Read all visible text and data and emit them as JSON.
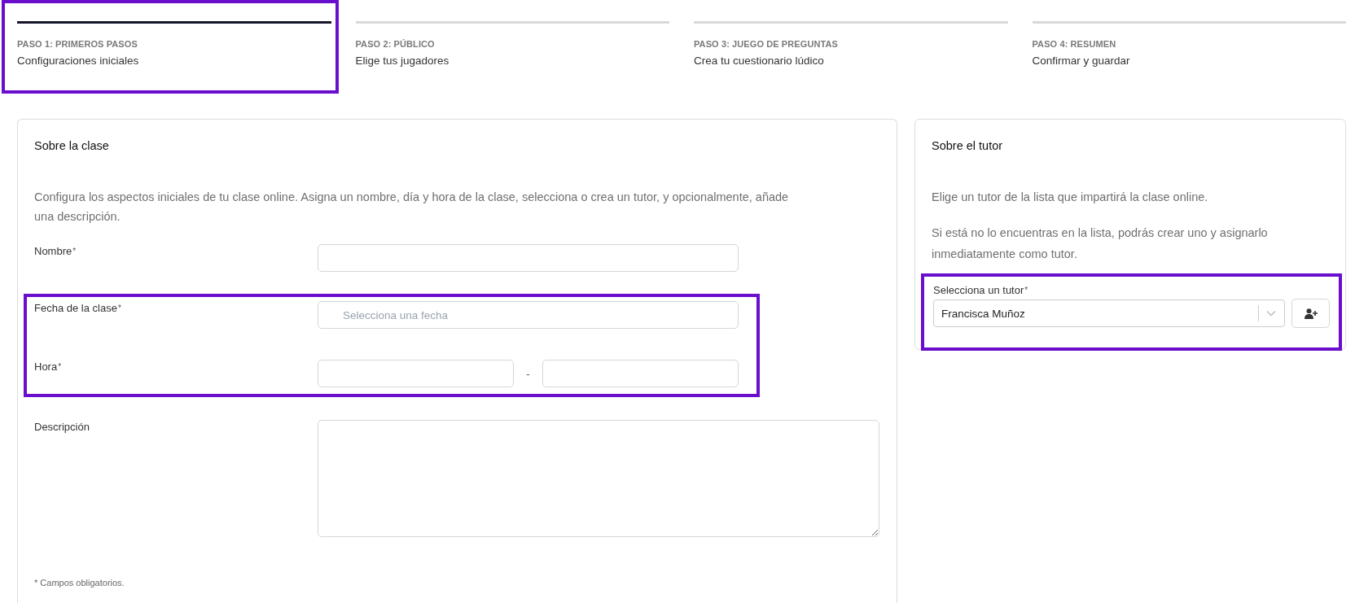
{
  "steps": [
    {
      "label": "PASO 1: PRIMEROS PASOS",
      "title": "Configuraciones iniciales",
      "selected": true,
      "highlighted": true
    },
    {
      "label": "PASO 2: PÚBLICO",
      "title": "Elige tus jugadores",
      "selected": false,
      "highlighted": false
    },
    {
      "label": "PASO 3: JUEGO DE PREGUNTAS",
      "title": "Crea tu cuestionario lúdico",
      "selected": false,
      "highlighted": false
    },
    {
      "label": "PASO 4: RESUMEN",
      "title": "Confirmar y guardar",
      "selected": false,
      "highlighted": false
    }
  ],
  "class_card": {
    "title": "Sobre la clase",
    "description": "Configura los aspectos iniciales de tu clase online. Asigna un nombre, día y hora de la clase, selecciona o crea un tutor, y opcionalmente, añade una descripción.",
    "fields": [
      {
        "kind": "text",
        "label": "Nombre",
        "required_mark": "*",
        "highlighted": false
      },
      {
        "kind": "date",
        "label": "Fecha de la clase",
        "required_mark": "*",
        "placeholder": "Selecciona una fecha",
        "highlighted": true
      },
      {
        "kind": "time-range",
        "label": "Hora",
        "required_mark": "*",
        "separator": "-",
        "highlighted": true
      },
      {
        "kind": "textarea",
        "label": "Descripción",
        "highlighted": false
      }
    ],
    "footnote": "* Campos obligatorios."
  },
  "tutor_card": {
    "title": "Sobre el tutor",
    "paragraphs": [
      "Elige un tutor de la lista que impartirá la clase online.",
      "Si está no lo encuentras en la lista, podrás crear uno y asignarlo inmediatamente como tutor."
    ],
    "select": {
      "label": "Selecciona un tutor",
      "required_mark": "*",
      "value": "Francisca Muñoz",
      "highlighted": true
    }
  }
}
